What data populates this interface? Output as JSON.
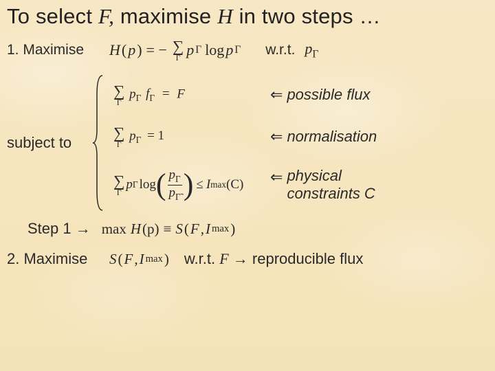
{
  "title": {
    "pre": "To select ",
    "F": "F,",
    "mid": " maximise ",
    "H": "H",
    "post": " in two steps …"
  },
  "line1": {
    "label": "1. Maximise",
    "Hp": "H",
    "p_open": "(",
    "p": "p",
    "p_close": ")",
    "eq": "= −",
    "sigma_sub": "Γ",
    "pG": "p",
    "G": "Γ",
    "log": "log",
    "wrt": "w.r.t.",
    "pG2": "p",
    "G2": "Γ"
  },
  "constraints": {
    "subject": "subject to",
    "c1": {
      "pG": "p",
      "G": "Γ",
      "f": "f",
      "eq": "=",
      "F": "F",
      "label": "possible flux"
    },
    "c2": {
      "pG": "p",
      "G": "Γ",
      "eq": "= 1",
      "label": "normalisation"
    },
    "c3": {
      "pG": "p",
      "G": "Γ",
      "log": "log",
      "num_p": "p",
      "num_G": "Γ",
      "den_p": "p",
      "den_G": "Γ̃",
      "le": "≤",
      "Imax": "I",
      "max": "max",
      "C": "(C)",
      "label1": "physical",
      "label2": "constraints C"
    }
  },
  "step1": {
    "label": "Step 1 →",
    "max": "max",
    "H": "H",
    "p": "(p)",
    "equiv": "≡",
    "S": "S",
    "open": "(",
    "F": "F",
    "comma": ", ",
    "I": "I",
    "imax": "max",
    "close": ")"
  },
  "step2": {
    "label": "2. Maximise",
    "S": "S",
    "open": "(",
    "F": "F",
    "comma": ", ",
    "I": "I",
    "imax": "max",
    "close": ")",
    "wrt": "w.r.t. ",
    "Fvar": "F",
    "arr": "  →  reproducible flux"
  },
  "arrows": {
    "left": "⇐",
    "right": "→"
  }
}
